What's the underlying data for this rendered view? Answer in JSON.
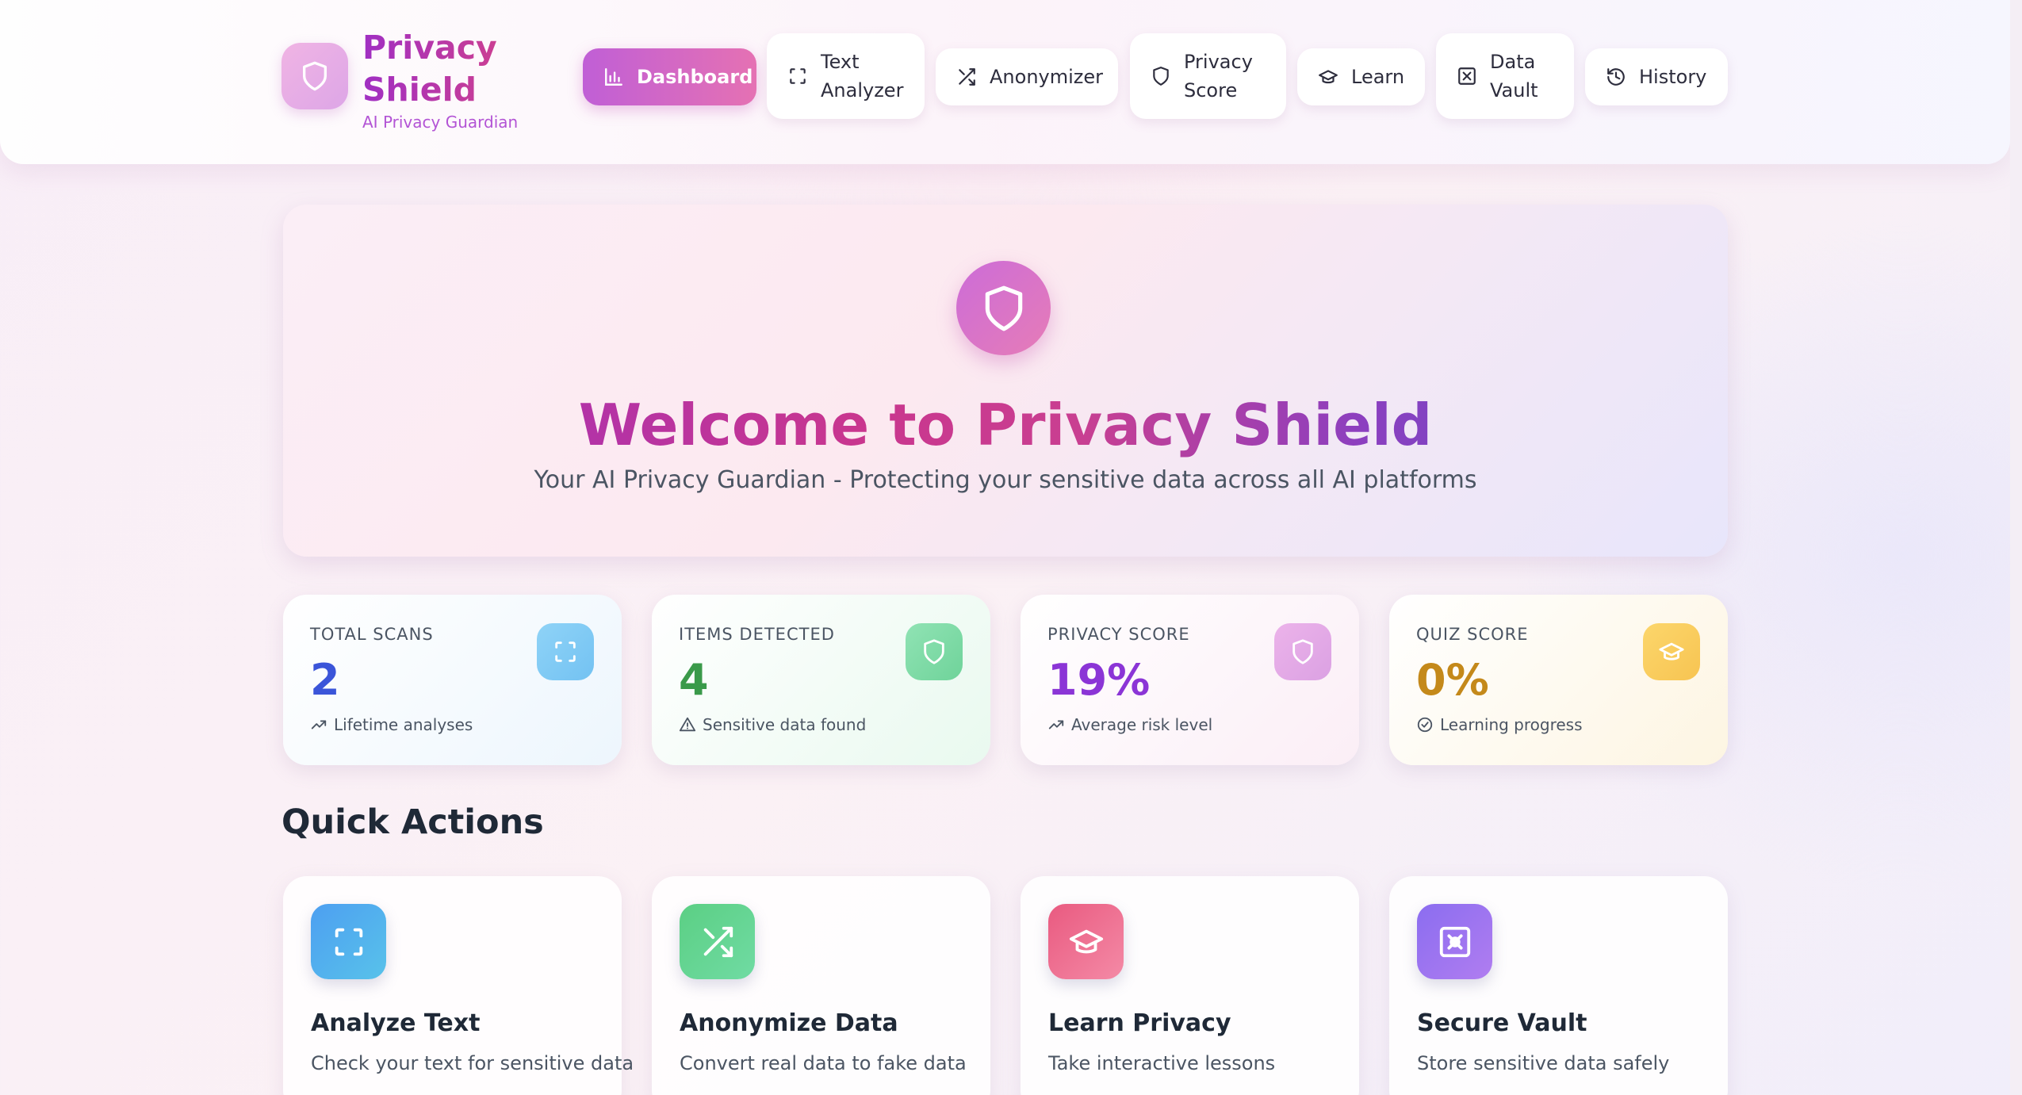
{
  "brand": {
    "name": "Privacy Shield",
    "tagline": "AI Privacy Guardian",
    "icon": "shield-icon"
  },
  "nav": {
    "items": [
      {
        "label": "Dashboard",
        "icon": "bar-chart-icon",
        "active": true
      },
      {
        "label": "Text Analyzer",
        "icon": "scan-icon",
        "active": false
      },
      {
        "label": "Anonymizer",
        "icon": "shuffle-icon",
        "active": false
      },
      {
        "label": "Privacy Score",
        "icon": "shield-icon",
        "active": false
      },
      {
        "label": "Learn",
        "icon": "graduation-cap-icon",
        "active": false
      },
      {
        "label": "Data Vault",
        "icon": "vault-icon",
        "active": false
      },
      {
        "label": "History",
        "icon": "history-icon",
        "active": false
      }
    ]
  },
  "hero": {
    "title": "Welcome to Privacy Shield",
    "subtitle": "Your AI Privacy Guardian - Protecting your sensitive data across all AI platforms",
    "icon": "shield-icon"
  },
  "stats": [
    {
      "label": "TOTAL SCANS",
      "value": "2",
      "footer": "Lifetime analyses",
      "footer_icon": "trending-up-icon",
      "icon": "scan-icon",
      "color": "#3b55d9"
    },
    {
      "label": "ITEMS DETECTED",
      "value": "4",
      "footer": "Sensitive data found",
      "footer_icon": "warning-icon",
      "icon": "shield-icon",
      "color": "#3a9a4a"
    },
    {
      "label": "PRIVACY SCORE",
      "value": "19%",
      "footer": "Average risk level",
      "footer_icon": "trending-up-icon",
      "icon": "shield-icon",
      "color": "#8b35d6"
    },
    {
      "label": "QUIZ SCORE",
      "value": "0%",
      "footer": "Learning progress",
      "footer_icon": "check-circle-icon",
      "icon": "graduation-cap-icon",
      "color": "#c4891a"
    }
  ],
  "quick_actions": {
    "title": "Quick Actions",
    "items": [
      {
        "title": "Analyze Text",
        "description": "Check your text for sensitive data",
        "icon": "scan-icon"
      },
      {
        "title": "Anonymize Data",
        "description": "Convert real data to fake data",
        "icon": "shuffle-icon"
      },
      {
        "title": "Learn Privacy",
        "description": "Take interactive lessons",
        "icon": "graduation-cap-icon"
      },
      {
        "title": "Secure Vault",
        "description": "Store sensitive data safely",
        "icon": "vault-icon"
      }
    ]
  }
}
